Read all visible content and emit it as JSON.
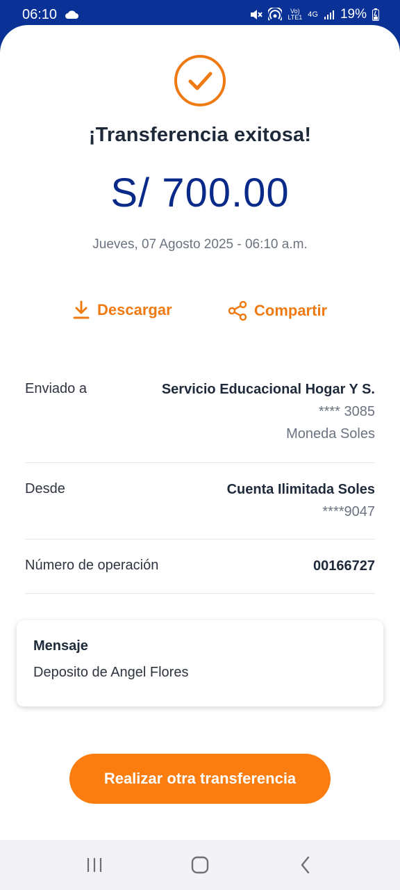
{
  "status_bar": {
    "time": "06:10",
    "battery": "19%",
    "network_top": "Vo)",
    "network_bottom": "LTE1",
    "signal_type": "4G",
    "icons": [
      "cloud-icon",
      "mute-icon",
      "hotspot-icon",
      "signal-icon",
      "battery-icon"
    ]
  },
  "receipt": {
    "title": "¡Transferencia exitosa!",
    "amount": "S/ 700.00",
    "datetime": "Jueves, 07 Agosto 2025 - 06:10 a.m.",
    "download_label": "Descargar",
    "share_label": "Compartir"
  },
  "details": {
    "sent_to": {
      "label": "Enviado a",
      "name": "Servicio Educacional Hogar Y S.",
      "account": "**** 3085",
      "currency": "Moneda Soles"
    },
    "from": {
      "label": "Desde",
      "name": "Cuenta Ilimitada Soles",
      "account": "****9047"
    },
    "operation": {
      "label": "Número de operación",
      "value": "00166727"
    }
  },
  "message": {
    "title": "Mensaje",
    "text": "Deposito de Angel Flores"
  },
  "cta_label": "Realizar otra transferencia",
  "colors": {
    "brand_blue": "#0a3296",
    "accent_orange": "#fb7d0f",
    "amount_blue": "#0a2a8a"
  }
}
